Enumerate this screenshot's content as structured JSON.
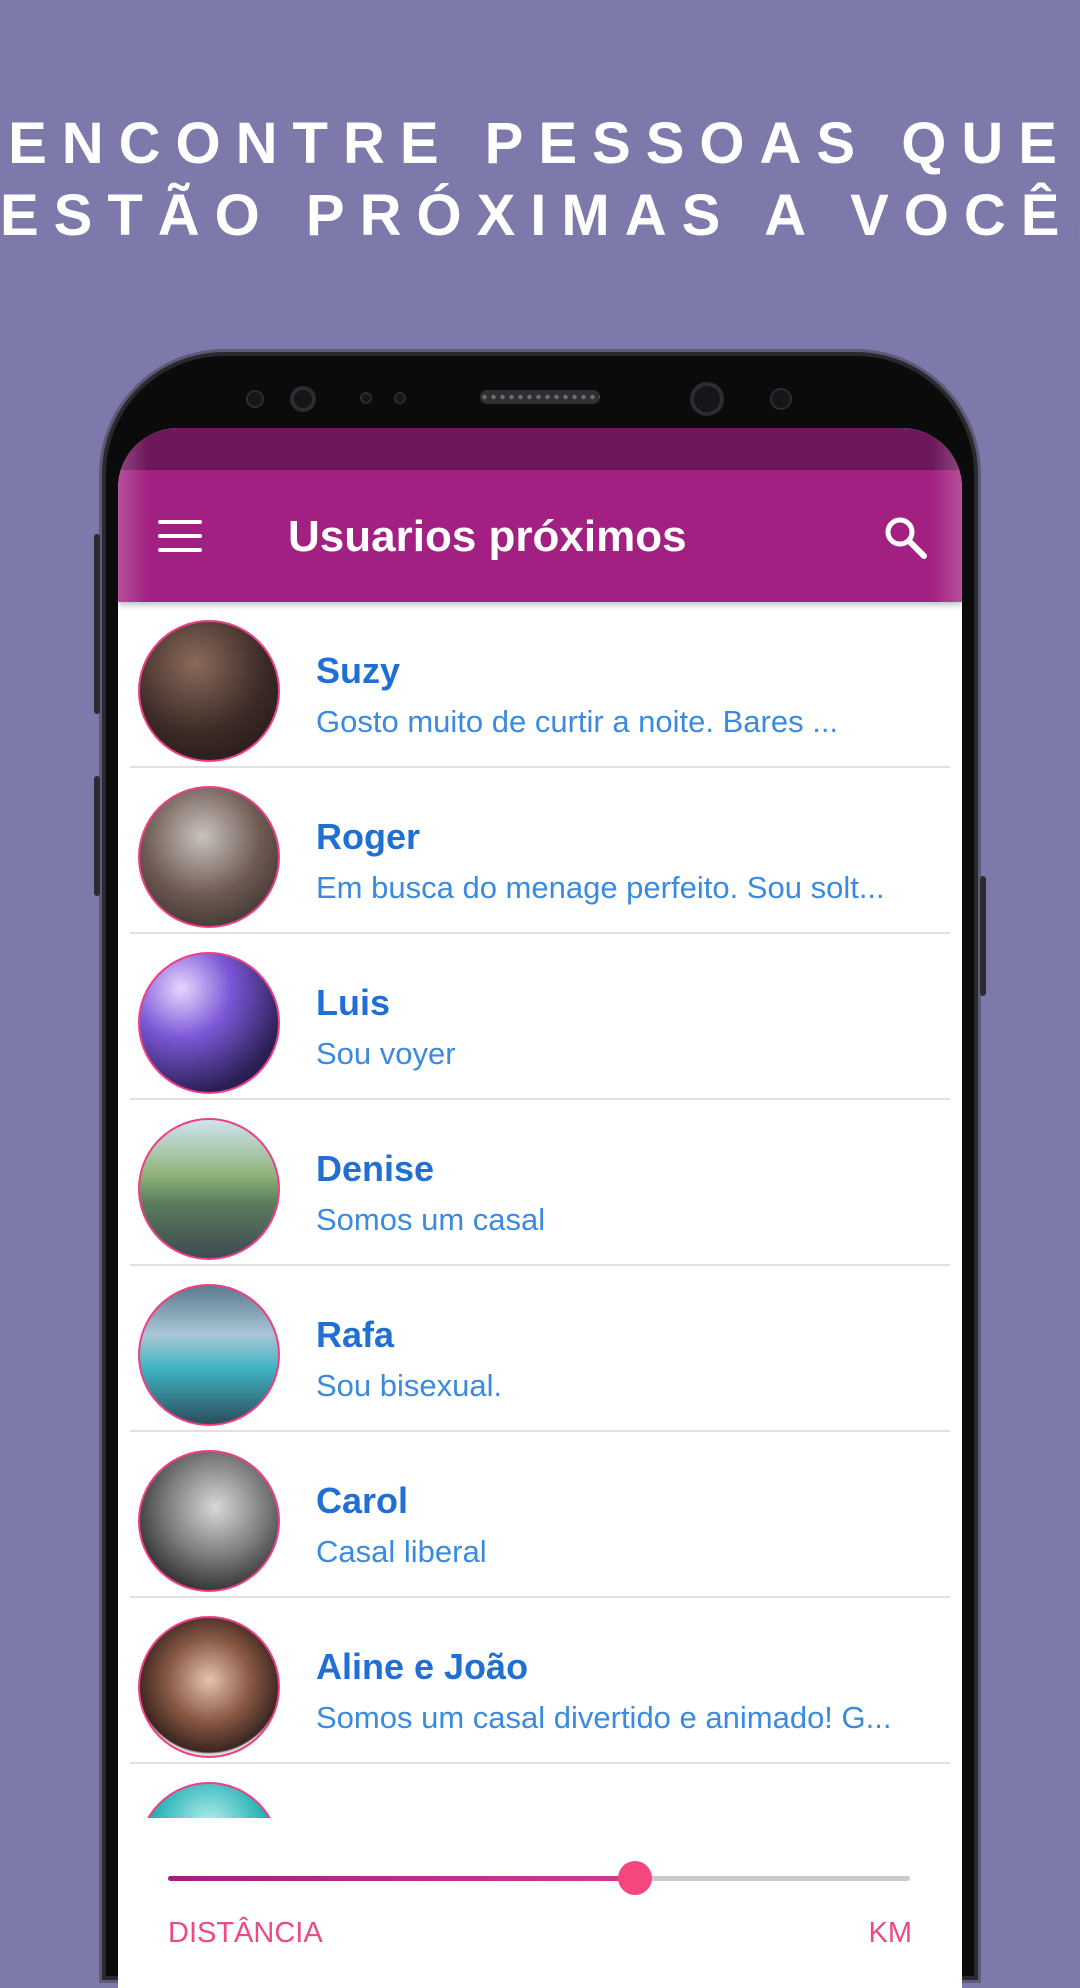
{
  "headline": {
    "line1": "ENCONTRE PESSOAS QUE",
    "line2": "ESTÃO PRÓXIMAS A VOCÊ!"
  },
  "appbar": {
    "title": "Usuarios próximos",
    "menu_icon": "menu-icon",
    "search_icon": "search-icon",
    "color": "#a12081",
    "statusbar_color": "#6f175c"
  },
  "users": [
    {
      "name": "Suzy",
      "description": "Gosto muito de curtir a noite. Bares ..."
    },
    {
      "name": "Roger",
      "description": "Em busca do menage perfeito. Sou solt..."
    },
    {
      "name": "Luis",
      "description": "Sou voyer"
    },
    {
      "name": "Denise",
      "description": "Somos um casal"
    },
    {
      "name": "Rafa",
      "description": "Sou bisexual."
    },
    {
      "name": "Carol",
      "description": "Casal liberal"
    },
    {
      "name": "Aline e João",
      "description": "Somos um casal divertido e animado! G..."
    }
  ],
  "distance_slider": {
    "label_left": "DISTÂNCIA",
    "label_right": "KM",
    "value_fraction": 0.63
  },
  "colors": {
    "background": "#7d79ab",
    "name_text": "#1f6fd4",
    "description_text": "#3a8be0",
    "accent": "#f3477e"
  }
}
